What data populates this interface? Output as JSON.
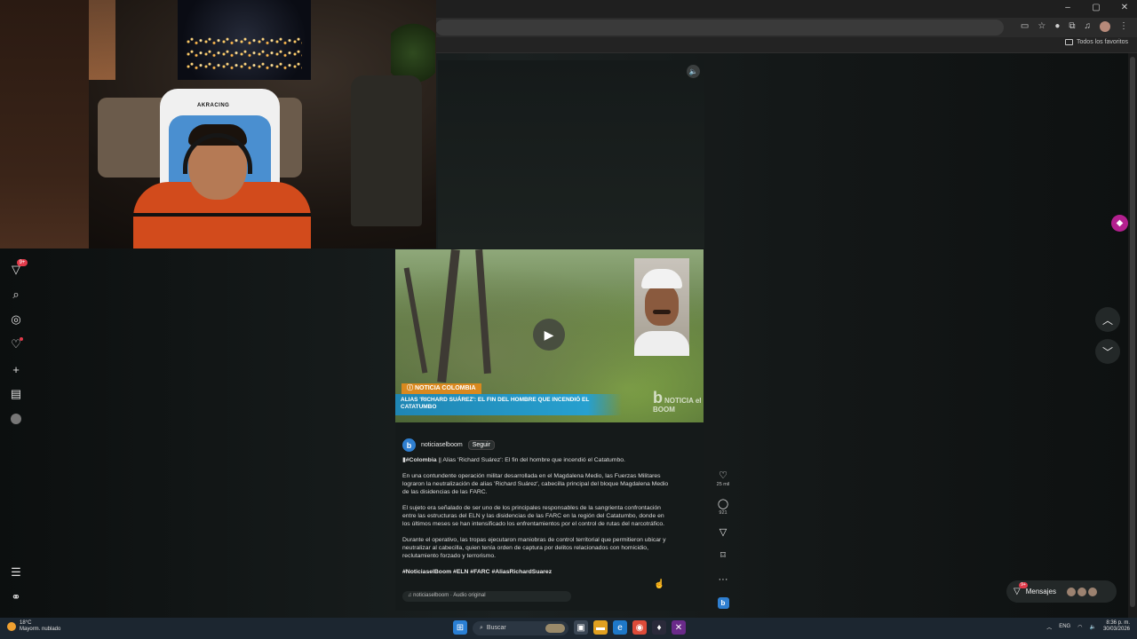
{
  "browser": {
    "window_controls": [
      "–",
      "▢",
      "✕"
    ],
    "bookmarks_label": "Todos los favoritos"
  },
  "webcam": {
    "chair_brand": "AKRACING"
  },
  "left_nav": {
    "notifications_badge": "9+",
    "items": [
      "home-icon",
      "search-icon",
      "explore-icon",
      "notifications-icon",
      "create-icon",
      "dashboard-icon",
      "profile-icon",
      "menu-icon",
      "more-apps-icon"
    ]
  },
  "post": {
    "news_tag": "NOTICIA COLOMBIA",
    "headline": "ALIAS 'RICHARD SUÁREZ': EL FIN DEL HOMBRE QUE INCENDIÓ EL CATATUMBO",
    "watermark": "NOTICIA el BOOM",
    "account": "noticiaselboom",
    "follow_label": "Seguir",
    "caption_lead_tag": "#Colombia",
    "caption_lead_text": " || Alias 'Richard Suárez': El fin del hombre que incendió el Catatumbo.",
    "paragraph_1": "En una contundente operación militar desarrollada en el Magdalena Medio, las Fuerzas Militares lograron la neutralización de alias 'Richard Suárez', cabecilla principal del bloque Magdalena Medio de las disidencias de las FARC.",
    "paragraph_2": "El sujeto era señalado de ser uno de los principales responsables de la sangrienta confrontación entre las estructuras del ELN y las disidencias de las FARC en la región del Catatumbo, donde en los últimos meses se han intensificado los enfrentamientos por el control de rutas del narcotráfico.",
    "paragraph_3": "Durante el operativo, las tropas ejecutaron maniobras de control territorial que permitieron ubicar y neutralizar al cabecilla, quien tenía orden de captura por delitos relacionados con homicidio, reclutamiento forzado y terrorismo.",
    "hashtags": "#NoticiaselBoom #ELN #FARC #AliasRichardSuarez",
    "audio": "noticiaselboom · Audio original"
  },
  "actions": {
    "likes": "25 mil",
    "comments": "921"
  },
  "messages": {
    "label": "Mensajes",
    "badge": "9+"
  },
  "taskbar": {
    "temperature": "18°C",
    "weather": "Mayorm. nublado",
    "search_placeholder": "Buscar",
    "language": "ENG",
    "time": "8:36 p. m.",
    "date": "30/03/2026"
  },
  "colors": {
    "accent_blue": "#27a0cf",
    "news_tag_orange": "#d9891f",
    "badge_red": "#e23a4a",
    "pin_magenta": "#b3208f"
  }
}
